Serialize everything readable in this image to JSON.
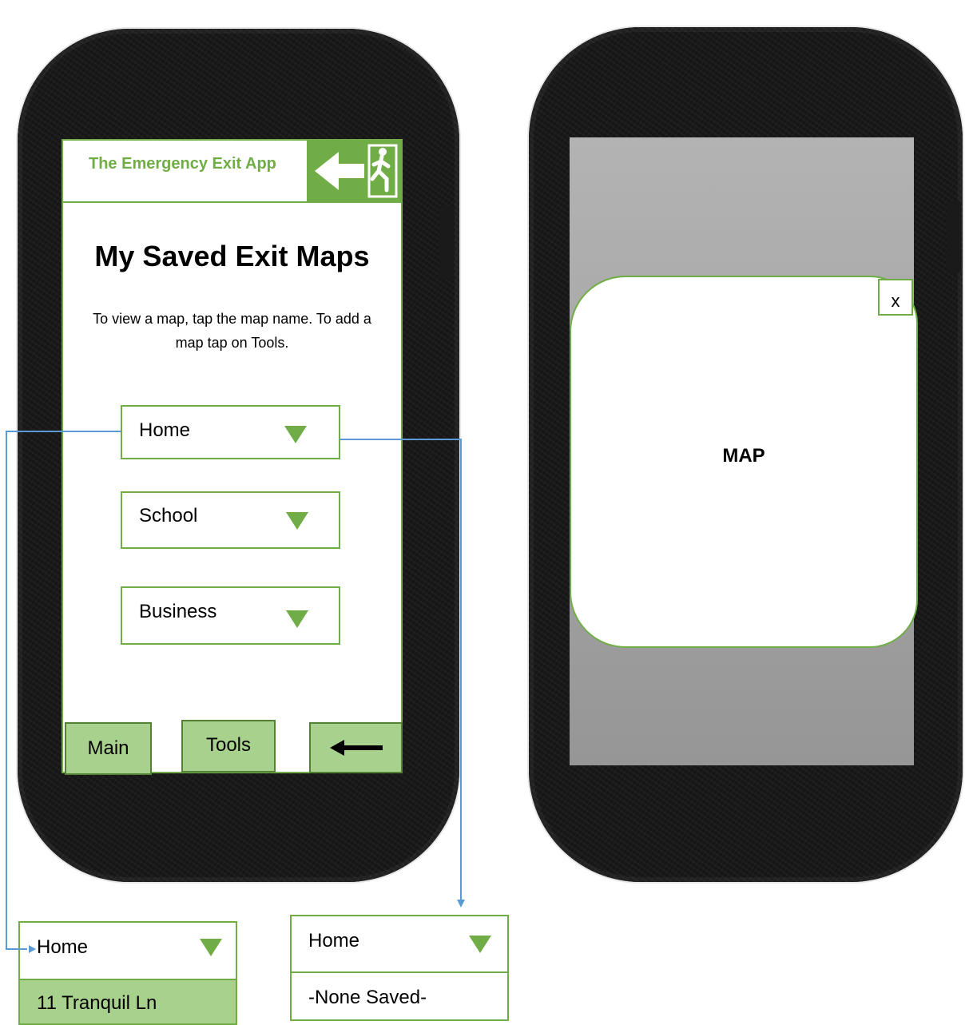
{
  "app": {
    "title": "The Emergency Exit App",
    "logo_icon": "exit-arrow-running-man-icon",
    "accent_color": "#70ad47",
    "button_fill_color": "#a9d18e"
  },
  "saved_maps_screen": {
    "heading": "My Saved Exit Maps",
    "instructions": "To view a map, tap the map name. To add a map tap on Tools.",
    "dropdowns": [
      {
        "label": "Home",
        "icon": "triangle-down-icon"
      },
      {
        "label": "School",
        "icon": "triangle-down-icon"
      },
      {
        "label": "Business",
        "icon": "triangle-down-icon"
      }
    ],
    "bottom_nav": {
      "main_label": "Main",
      "tools_label": "Tools",
      "back_icon": "left-arrow-icon"
    }
  },
  "map_screen": {
    "map_label": "MAP",
    "close_label": "x"
  },
  "expanded_dropdowns": [
    {
      "label": "Home",
      "option": "11 Tranquil Ln"
    },
    {
      "label": "Home",
      "option": "-None Saved-"
    }
  ]
}
